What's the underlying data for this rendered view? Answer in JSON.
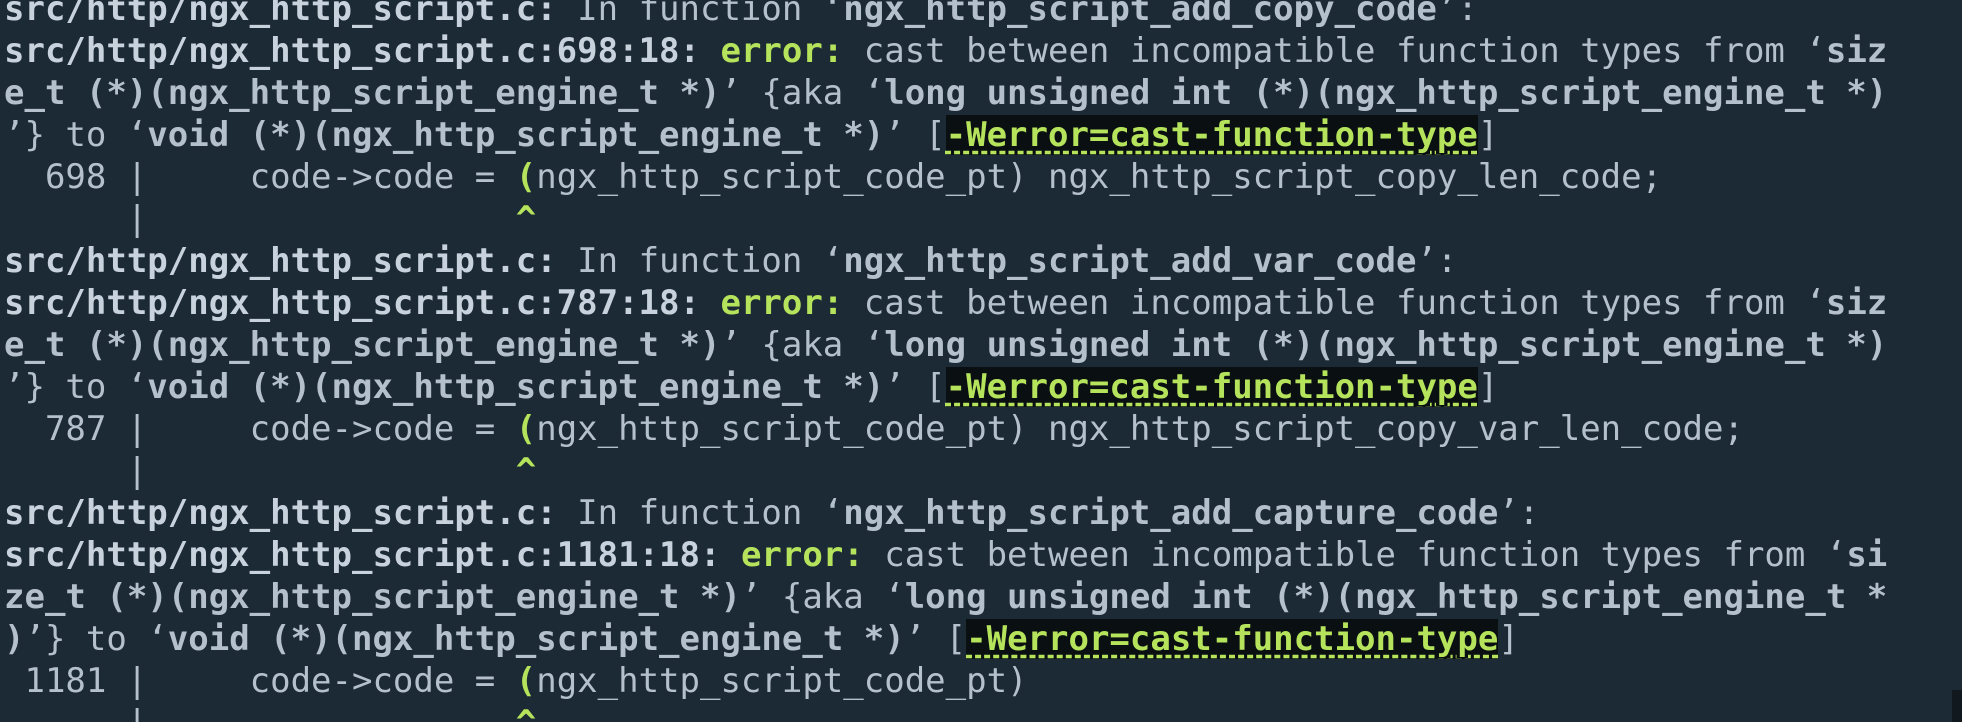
{
  "terminal": {
    "lines": [
      [
        {
          "t": "src/http/ngx_http_script.c:",
          "s": "path"
        },
        {
          "t": " In function ‘",
          "s": ""
        },
        {
          "t": "ngx_http_script_add_copy_code",
          "s": "bold"
        },
        {
          "t": "’:",
          "s": ""
        }
      ],
      [
        {
          "t": "src/http/ngx_http_script.c:698:18:",
          "s": "path"
        },
        {
          "t": " ",
          "s": ""
        },
        {
          "t": "error:",
          "s": "err"
        },
        {
          "t": " cast between incompatible function types from ‘",
          "s": ""
        },
        {
          "t": "siz",
          "s": "bold"
        }
      ],
      [
        {
          "t": "e_t (*)(ngx_http_script_engine_t *)",
          "s": "bold"
        },
        {
          "t": "’ {aka ‘",
          "s": ""
        },
        {
          "t": "long unsigned int (*)(ngx_http_script_engine_t *)",
          "s": "bold"
        }
      ],
      [
        {
          "t": "’} to ‘",
          "s": ""
        },
        {
          "t": "void (*)(ngx_http_script_engine_t *)",
          "s": "bold"
        },
        {
          "t": "’ [",
          "s": ""
        },
        {
          "t": "-Werror=cast-function-type",
          "s": "flag"
        },
        {
          "t": "]",
          "s": ""
        }
      ],
      [
        {
          "t": "  698 |     code->code = ",
          "s": ""
        },
        {
          "t": "(",
          "s": "caret"
        },
        {
          "t": "ngx_http_script_code_pt) ngx_http_script_copy_len_code;",
          "s": ""
        }
      ],
      [
        {
          "t": "      |                  ",
          "s": ""
        },
        {
          "t": "^",
          "s": "caret"
        }
      ],
      [
        {
          "t": "src/http/ngx_http_script.c:",
          "s": "path"
        },
        {
          "t": " In function ‘",
          "s": ""
        },
        {
          "t": "ngx_http_script_add_var_code",
          "s": "bold"
        },
        {
          "t": "’:",
          "s": ""
        }
      ],
      [
        {
          "t": "src/http/ngx_http_script.c:787:18:",
          "s": "path"
        },
        {
          "t": " ",
          "s": ""
        },
        {
          "t": "error:",
          "s": "err"
        },
        {
          "t": " cast between incompatible function types from ‘",
          "s": ""
        },
        {
          "t": "siz",
          "s": "bold"
        }
      ],
      [
        {
          "t": "e_t (*)(ngx_http_script_engine_t *)",
          "s": "bold"
        },
        {
          "t": "’ {aka ‘",
          "s": ""
        },
        {
          "t": "long unsigned int (*)(ngx_http_script_engine_t *)",
          "s": "bold"
        }
      ],
      [
        {
          "t": "’} to ‘",
          "s": ""
        },
        {
          "t": "void (*)(ngx_http_script_engine_t *)",
          "s": "bold"
        },
        {
          "t": "’ [",
          "s": ""
        },
        {
          "t": "-Werror=cast-function-type",
          "s": "flag"
        },
        {
          "t": "]",
          "s": ""
        }
      ],
      [
        {
          "t": "  787 |     code->code = ",
          "s": ""
        },
        {
          "t": "(",
          "s": "caret"
        },
        {
          "t": "ngx_http_script_code_pt) ngx_http_script_copy_var_len_code;",
          "s": ""
        }
      ],
      [
        {
          "t": "      |                  ",
          "s": ""
        },
        {
          "t": "^",
          "s": "caret"
        }
      ],
      [
        {
          "t": "src/http/ngx_http_script.c:",
          "s": "path"
        },
        {
          "t": " In function ‘",
          "s": ""
        },
        {
          "t": "ngx_http_script_add_capture_code",
          "s": "bold"
        },
        {
          "t": "’:",
          "s": ""
        }
      ],
      [
        {
          "t": "src/http/ngx_http_script.c:1181:18:",
          "s": "path"
        },
        {
          "t": " ",
          "s": ""
        },
        {
          "t": "error:",
          "s": "err"
        },
        {
          "t": " cast between incompatible function types from ‘",
          "s": ""
        },
        {
          "t": "si",
          "s": "bold"
        }
      ],
      [
        {
          "t": "ze_t (*)(ngx_http_script_engine_t *)",
          "s": "bold"
        },
        {
          "t": "’ {aka ‘",
          "s": ""
        },
        {
          "t": "long unsigned int (*)(ngx_http_script_engine_t *",
          "s": "bold"
        }
      ],
      [
        {
          "t": ")",
          "s": "bold"
        },
        {
          "t": "’} to ‘",
          "s": ""
        },
        {
          "t": "void (*)(ngx_http_script_engine_t *)",
          "s": "bold"
        },
        {
          "t": "’ [",
          "s": ""
        },
        {
          "t": "-Werror=cast-function-type",
          "s": "flag"
        },
        {
          "t": "]",
          "s": ""
        }
      ],
      [
        {
          "t": " 1181 |     code->code = ",
          "s": ""
        },
        {
          "t": "(",
          "s": "caret"
        },
        {
          "t": "ngx_http_script_code_pt)",
          "s": ""
        }
      ],
      [
        {
          "t": "      |                  ",
          "s": ""
        },
        {
          "t": "^",
          "s": "caret"
        }
      ]
    ]
  }
}
